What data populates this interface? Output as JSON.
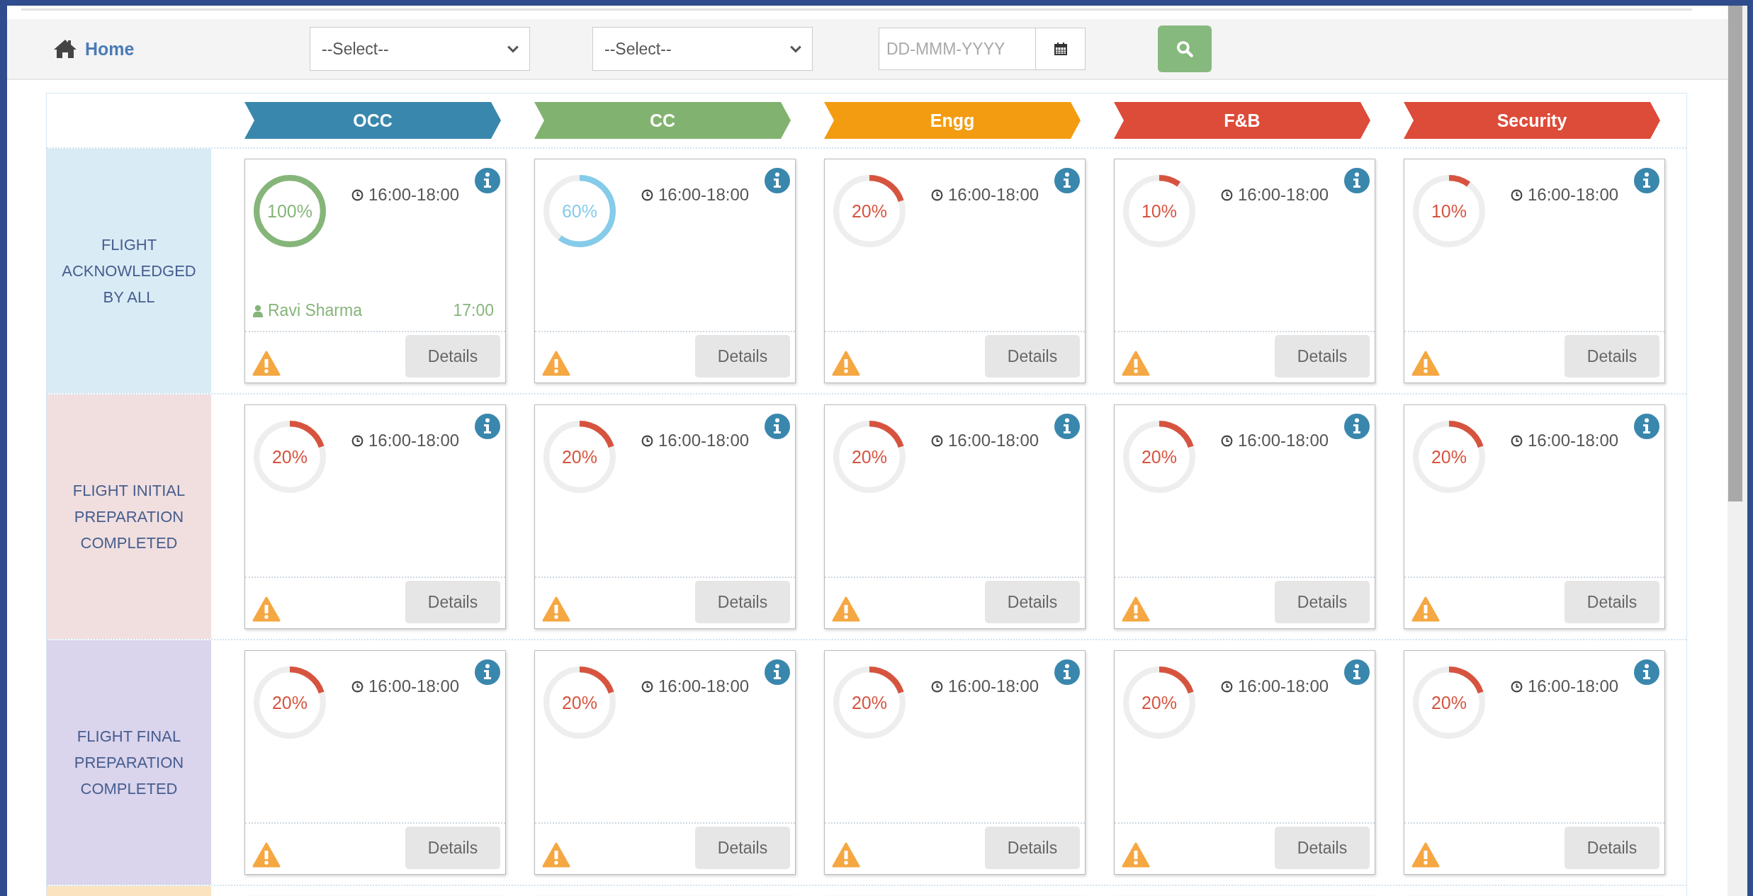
{
  "toolbar": {
    "home": "Home",
    "selects": [
      {
        "value": "--Select--"
      },
      {
        "value": "--Select--"
      }
    ],
    "date": {
      "placeholder": "DD-MMM-YYYY"
    }
  },
  "columns": [
    {
      "label": "OCC",
      "color": "#3a87ad"
    },
    {
      "label": "CC",
      "color": "#82b270"
    },
    {
      "label": "Engg",
      "color": "#f39c12"
    },
    {
      "label": "F&B",
      "color": "#dd4b39"
    },
    {
      "label": "Security",
      "color": "#dd4b39"
    }
  ],
  "rows": [
    {
      "label": "FLIGHT ACKNOWLEDGED BY ALL",
      "color": "#d9ebf5",
      "cards": [
        {
          "percent": "100%",
          "level": 1,
          "color": "#86b57a",
          "time": "16:00-18:00",
          "user": "Ravi Sharma",
          "user_time": "17:00",
          "button": "Details"
        },
        {
          "percent": "60%",
          "level": 0.6,
          "color": "#85cbea",
          "time": "16:00-18:00",
          "button": "Details"
        },
        {
          "percent": "20%",
          "level": 0.2,
          "color": "#d6543f",
          "time": "16:00-18:00",
          "button": "Details"
        },
        {
          "percent": "10%",
          "level": 0.1,
          "color": "#d6543f",
          "time": "16:00-18:00",
          "button": "Details"
        },
        {
          "percent": "10%",
          "level": 0.1,
          "color": "#d6543f",
          "time": "16:00-18:00",
          "button": "Details"
        }
      ]
    },
    {
      "label": "FLIGHT INITIAL PREPARATION COMPLETED",
      "color": "#f1dfdf",
      "cards": [
        {
          "percent": "20%",
          "level": 0.2,
          "color": "#d6543f",
          "time": "16:00-18:00",
          "button": "Details"
        },
        {
          "percent": "20%",
          "level": 0.2,
          "color": "#d6543f",
          "time": "16:00-18:00",
          "button": "Details"
        },
        {
          "percent": "20%",
          "level": 0.2,
          "color": "#d6543f",
          "time": "16:00-18:00",
          "button": "Details"
        },
        {
          "percent": "20%",
          "level": 0.2,
          "color": "#d6543f",
          "time": "16:00-18:00",
          "button": "Details"
        },
        {
          "percent": "20%",
          "level": 0.2,
          "color": "#d6543f",
          "time": "16:00-18:00",
          "button": "Details"
        }
      ]
    },
    {
      "label": "FLIGHT FINAL PREPARATION COMPLETED",
      "color": "#dad4ec",
      "cards": [
        {
          "percent": "20%",
          "level": 0.2,
          "color": "#d6543f",
          "time": "16:00-18:00",
          "button": "Details"
        },
        {
          "percent": "20%",
          "level": 0.2,
          "color": "#d6543f",
          "time": "16:00-18:00",
          "button": "Details"
        },
        {
          "percent": "20%",
          "level": 0.2,
          "color": "#d6543f",
          "time": "16:00-18:00",
          "button": "Details"
        },
        {
          "percent": "20%",
          "level": 0.2,
          "color": "#d6543f",
          "time": "16:00-18:00",
          "button": "Details"
        },
        {
          "percent": "20%",
          "level": 0.2,
          "color": "#d6543f",
          "time": "16:00-18:00",
          "button": "Details"
        }
      ]
    },
    {
      "color": "#fbe3c0"
    }
  ]
}
